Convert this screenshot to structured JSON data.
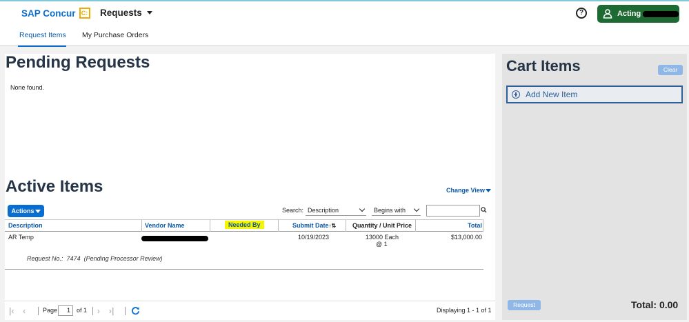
{
  "header": {
    "logo_text": "SAP Concur",
    "logo_mark": "C:",
    "app_menu": "Requests",
    "help": "?",
    "acting_label": "Acting"
  },
  "tabs": [
    {
      "label": "Request Items",
      "active": true
    },
    {
      "label": "My Purchase Orders",
      "active": false
    }
  ],
  "pending": {
    "title": "Pending Requests",
    "empty_text": "None found."
  },
  "active_items": {
    "title": "Active Items",
    "change_view": "Change View",
    "actions_label": "Actions",
    "search_label": "Search:",
    "search_field": "Description",
    "search_mode": "Begins with",
    "search_value": "",
    "columns": [
      "Description",
      "Vendor Name",
      "Needed By",
      "Submit Date",
      "Quantity / Unit Price",
      "Total"
    ],
    "rows": [
      {
        "description": "AR Temp",
        "vendor": "",
        "needed_by": "",
        "submit_date": "10/19/2023",
        "quantity": "13000 Each",
        "unit_price": "@ 1",
        "total": "$13,000.00",
        "request_no_label": "Request No.:",
        "request_no": "7474",
        "request_status": "(Pending Processor Review)"
      }
    ],
    "pager": {
      "page_label": "Page",
      "page": "1",
      "of_label": "of 1",
      "displaying": "Displaying 1 - 1 of 1"
    }
  },
  "cart": {
    "title": "Cart Items",
    "clear_label": "Clear",
    "add_item_label": "Add New Item",
    "request_label": "Request",
    "total_label": "Total: 0.00"
  },
  "colors": {
    "brand_blue": "#0a6ed1",
    "acting_green": "#1d6b33",
    "highlight_yellow": "#f5f500",
    "heading": "#253446"
  }
}
